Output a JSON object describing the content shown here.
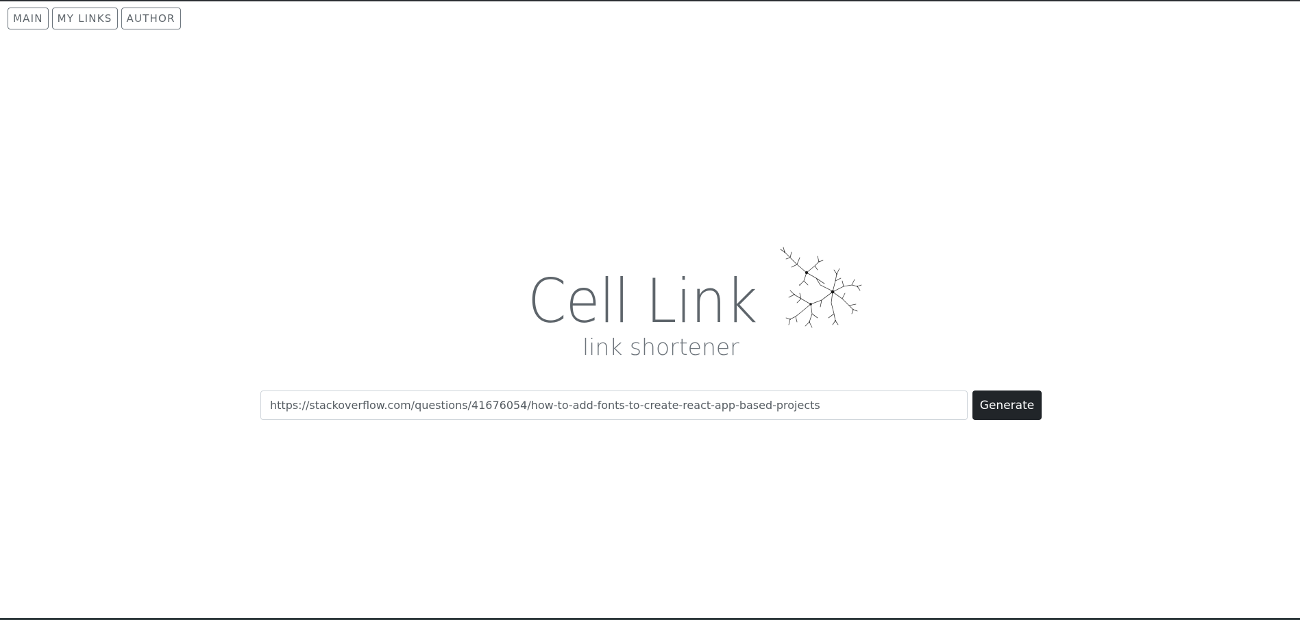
{
  "nav": {
    "items": [
      {
        "label": "MAIN"
      },
      {
        "label": "MY LINKS"
      },
      {
        "label": "AUTHOR"
      }
    ]
  },
  "brand": {
    "title": "Cell Link",
    "subtitle": "link shortener",
    "logo_icon": "neuron-icon"
  },
  "shortener": {
    "url_value": "https://stackoverflow.com/questions/41676054/how-to-add-fonts-to-create-react-app-based-projects",
    "generate_label": "Generate"
  },
  "colors": {
    "text_muted": "#5e656b",
    "button_dark": "#212529",
    "border": "#6c757d"
  }
}
